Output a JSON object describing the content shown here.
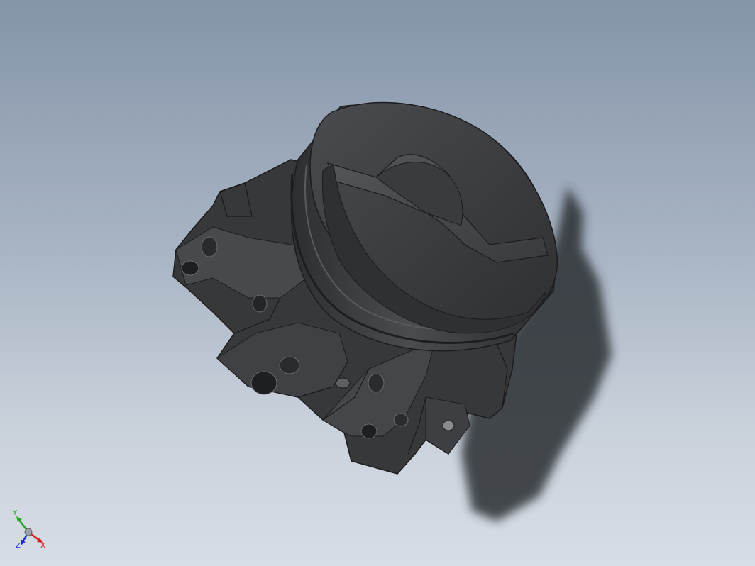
{
  "viewport": {
    "background_top": "#8594a9",
    "background_bottom": "#d7dde5"
  },
  "model": {
    "body_color": "#3a3b3d",
    "shadow_color": "#2e3034"
  },
  "triad": {
    "x_label": "X",
    "y_label": "Y",
    "z_label": "Z",
    "x_color": "#d22020",
    "y_color": "#1fa81f",
    "z_color": "#2030d0"
  }
}
